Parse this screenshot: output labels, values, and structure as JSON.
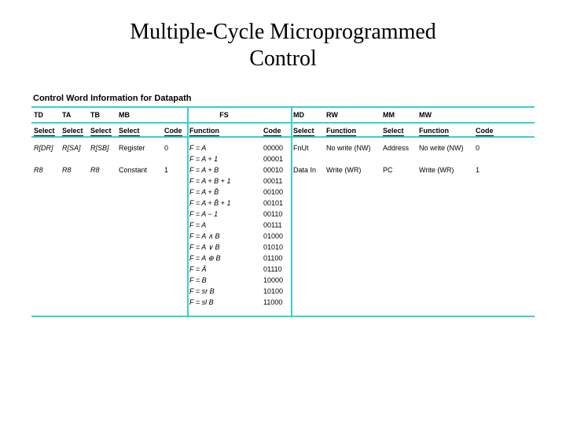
{
  "title_line1": "Multiple-Cycle Microprogrammed",
  "title_line2": "Control",
  "caption": "Control Word Information for Datapath",
  "groups": {
    "td": "TD",
    "ta": "TA",
    "tb": "TB",
    "mb": "MB",
    "fs": "FS",
    "md": "MD",
    "rw": "RW",
    "mm": "MM",
    "mw": "MW"
  },
  "sub": {
    "select": "Select",
    "code": "Code",
    "function": "Function"
  },
  "row1": {
    "td": "R[DR]",
    "ta": "R[SA]",
    "tb": "R[SB]",
    "mb_sel": "Register",
    "mb_code": "0",
    "md": "FnUt",
    "rw": "No write (NW)",
    "mm": "Address",
    "mw_fun": "No write (NW)",
    "mw_code": "0"
  },
  "row2": {
    "td": "R8",
    "ta": "R8",
    "tb": "R8",
    "mb_sel": "Constant",
    "mb_code": "1",
    "md": "Data In",
    "rw": "Write (WR)",
    "mm": "PC",
    "mw_fun": "Write (WR)",
    "mw_code": "1"
  },
  "fs": [
    {
      "fn": "F = A",
      "code": "00000"
    },
    {
      "fn": "F = A + 1",
      "code": "00001"
    },
    {
      "fn": "F = A + B",
      "code": "00010"
    },
    {
      "fn": "F = A + B + 1",
      "code": "00011"
    },
    {
      "fn": "F = A + B̄",
      "code": "00100"
    },
    {
      "fn": "F = A + B̄ + 1",
      "code": "00101"
    },
    {
      "fn": "F = A − 1",
      "code": "00110"
    },
    {
      "fn": "F = A",
      "code": "00111"
    },
    {
      "fn": "F = A ∧ B",
      "code": "01000"
    },
    {
      "fn": "F = A ∨ B",
      "code": "01010"
    },
    {
      "fn": "F = A ⊕ B",
      "code": "01100"
    },
    {
      "fn": "F = Ā",
      "code": "01110"
    },
    {
      "fn": "F = B",
      "code": "10000"
    },
    {
      "fn": "F = sr B",
      "code": "10100"
    },
    {
      "fn": "F = sl B",
      "code": "11000"
    }
  ]
}
